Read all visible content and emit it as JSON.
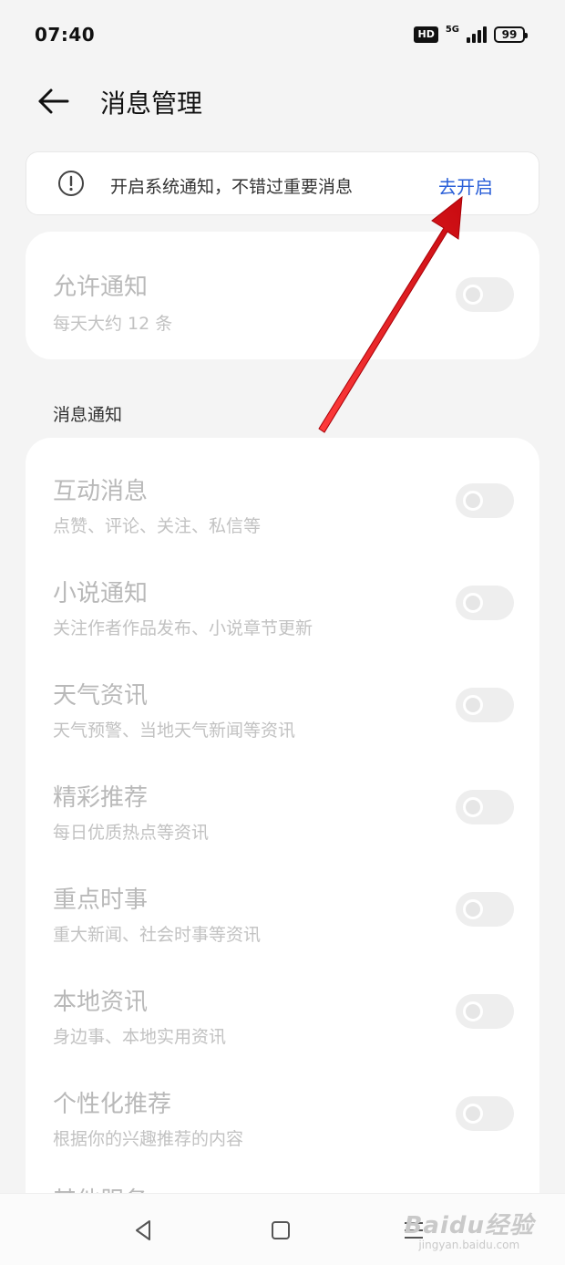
{
  "status_bar": {
    "time": "07:40",
    "hd_label": "HD",
    "network_label": "5G",
    "battery_level": "99"
  },
  "header": {
    "back_icon": "arrow-left-icon",
    "title": "消息管理"
  },
  "banner": {
    "icon": "alert-circle-icon",
    "text": "开启系统通知，不错过重要消息",
    "action_label": "去开启",
    "action_color": "#2a5fd8"
  },
  "allow_notifications": {
    "title": "允许通知",
    "subtitle": "每天大约 12 条",
    "enabled": false
  },
  "section_label": "消息通知",
  "notification_items": [
    {
      "title": "互动消息",
      "subtitle": "点赞、评论、关注、私信等",
      "enabled": false
    },
    {
      "title": "小说通知",
      "subtitle": "关注作者作品发布、小说章节更新",
      "enabled": false
    },
    {
      "title": "天气资讯",
      "subtitle": "天气预警、当地天气新闻等资讯",
      "enabled": false
    },
    {
      "title": "精彩推荐",
      "subtitle": "每日优质热点等资讯",
      "enabled": false
    },
    {
      "title": "重点时事",
      "subtitle": "重大新闻、社会时事等资讯",
      "enabled": false
    },
    {
      "title": "本地资讯",
      "subtitle": "身边事、本地实用资讯",
      "enabled": false
    },
    {
      "title": "个性化推荐",
      "subtitle": "根据你的兴趣推荐的内容",
      "enabled": false
    }
  ],
  "partial_item_title": "其他服务",
  "nav_bar": {
    "back_icon": "triangle-back-icon",
    "home_icon": "square-home-icon",
    "menu_icon": "menu-lines-icon"
  },
  "watermark": {
    "logo": "Baidu经验",
    "url": "jingyan.baidu.com"
  },
  "annotation": {
    "arrow_color": "#e8141b"
  }
}
